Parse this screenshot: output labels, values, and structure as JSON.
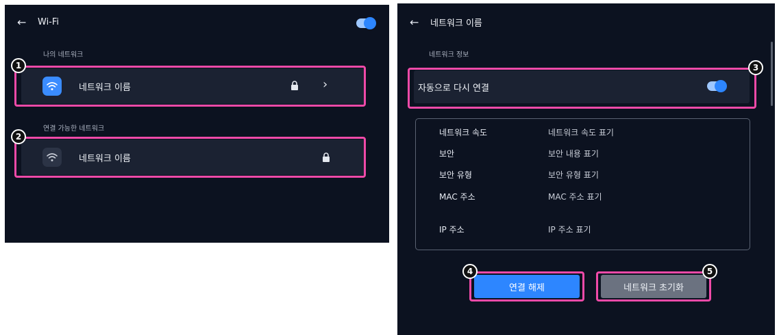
{
  "left": {
    "back_icon": "←",
    "title": "Wi-Fi",
    "wifi_toggle_on": true,
    "my_network_label": "나의 네트워크",
    "my_network_name": "네트워크 이름",
    "available_label": "연결 가능한 네트워크",
    "available_network_name": "네트워크 이름"
  },
  "right": {
    "back_icon": "←",
    "title": "네트워크 이름",
    "info_section_label": "네트워크 정보",
    "auto_reconnect_label": "자동으로 다시 연결",
    "auto_reconnect_on": true,
    "info_rows": [
      {
        "label": "네트워크 속도",
        "value": "네트워크 속도 표기"
      },
      {
        "label": "보안",
        "value": "보안 내용 표기"
      },
      {
        "label": "보안 유형",
        "value": "보안 유형 표기"
      },
      {
        "label": "MAC 주소",
        "value": "MAC 주소 표기"
      },
      {
        "label": "IP 주소",
        "value": "IP 주소 표기"
      }
    ],
    "disconnect_label": "연결 해제",
    "reset_label": "네트워크 초기화"
  },
  "markers": [
    "1",
    "2",
    "3",
    "4",
    "5"
  ],
  "icons": {
    "back": "arrow-left-icon",
    "wifi": "wifi-icon",
    "lock": "lock-icon",
    "chevron": "chevron-right-icon"
  },
  "colors": {
    "background": "#0c1220",
    "row": "#1b2232",
    "accent_blue": "#2d86ff",
    "highlight_pink": "#f04aa8",
    "reset_button": "#6b7280"
  }
}
